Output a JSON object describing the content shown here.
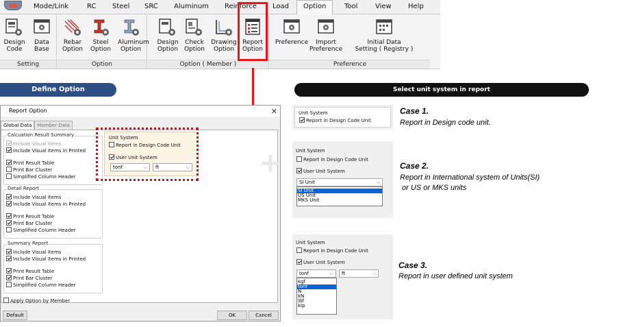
{
  "menubar": {
    "items": [
      "Mode/Link",
      "RC",
      "Steel",
      "SRC",
      "Aluminum",
      "Reinforce",
      "Load",
      "Option",
      "Tool",
      "View",
      "Help"
    ],
    "active": "Option"
  },
  "ribbon": {
    "groups": {
      "setting": "Setting",
      "option": "Option",
      "member": "Option ( Member )",
      "preference": "Preference"
    },
    "buttons": {
      "design_code": [
        "Design",
        "Code"
      ],
      "data_base": [
        "Data",
        "Base"
      ],
      "rebar_option": [
        "Rebar",
        "Option"
      ],
      "steel_option": [
        "Steel",
        "Option"
      ],
      "aluminum_option": [
        "Aluminum",
        "Option"
      ],
      "design_option": [
        "Design",
        "Option"
      ],
      "check_option": [
        "Check",
        "Option"
      ],
      "drawing_option": [
        "Drawing",
        "Option"
      ],
      "report_option": [
        "Report",
        "Option"
      ],
      "preference": [
        "Preference",
        ""
      ],
      "import_preference": [
        "Import",
        "Preference"
      ],
      "initial_data": [
        "Initial Data",
        "Setting ( Registry )"
      ]
    }
  },
  "banners": {
    "left": "Define Option",
    "right": "Select unit system in report"
  },
  "dialog": {
    "title": "Report Option",
    "tabs": [
      "Global Data",
      "Member Data"
    ],
    "calc_summary": {
      "legend": "Calcuation Result Summary",
      "include_visual": "Include Visual Items",
      "include_visual_printed": "Include Visual Items in Printed",
      "print_result_table": "Print Result Table",
      "print_bar_cluster": "Print Bar Cluster",
      "simplified_header": "Simplified Column Header"
    },
    "detail_report": {
      "legend": "Detail Report",
      "include_visual": "Include Visual Items",
      "include_visual_printed": "Include Visual Items in Printed",
      "print_result_table": "Print Result Table",
      "print_bar_cluster": "Print Bar Cluster",
      "simplified_header": "Simplified Column Header"
    },
    "summary_report": {
      "legend": "Summary Report",
      "include_visual": "Include Visual Items",
      "include_visual_printed": "Include Visual Items in Printed",
      "print_result_table": "Print Result Table",
      "print_bar_cluster": "Print Bar Cluster",
      "simplified_header": "Simplified Column Header"
    },
    "unit_system": {
      "legend": "Unit System",
      "design_code_unit": "Report in Design Code Unit",
      "user_unit": "User Unit System",
      "force": "tonf",
      "length": "ft"
    },
    "apply_by_member": "Apply Option by Member",
    "default_button": "Default",
    "ok_button": "OK",
    "cancel_button": "Cancel"
  },
  "cases": {
    "case1": {
      "title": "Case 1.",
      "desc": "Report in Design code unit.",
      "legend": "Unit System",
      "design_code_unit": "Report in Design Code Unit"
    },
    "case2": {
      "title": "Case 2.",
      "desc_line1": "Report in International system of Units(SI)",
      "desc_line2": " or US or MKS units",
      "legend": "Unit System",
      "design_code_unit": "Report in Design Code Unit",
      "user_unit": "User Unit System",
      "selected": "SI Unit",
      "options": [
        "SI Unit",
        "US Unit",
        "MKS Unit"
      ]
    },
    "case3": {
      "title": "Case 3.",
      "desc": "Report in user defined unit system",
      "legend": "Unit System",
      "design_code_unit": "Report in Design Code Unit",
      "user_unit": "User Unit System",
      "force": "tonf",
      "length": "ft",
      "options": [
        "kgf",
        "tonf",
        "N",
        "kN",
        "lbf",
        "kip"
      ]
    }
  },
  "colors": {
    "highlight_red": "#e8161b",
    "banner_blue": "#2e4f86",
    "banner_black": "#111111",
    "unit_panel_bg": "#fbf3e4",
    "selection_blue": "#0a64d6"
  }
}
